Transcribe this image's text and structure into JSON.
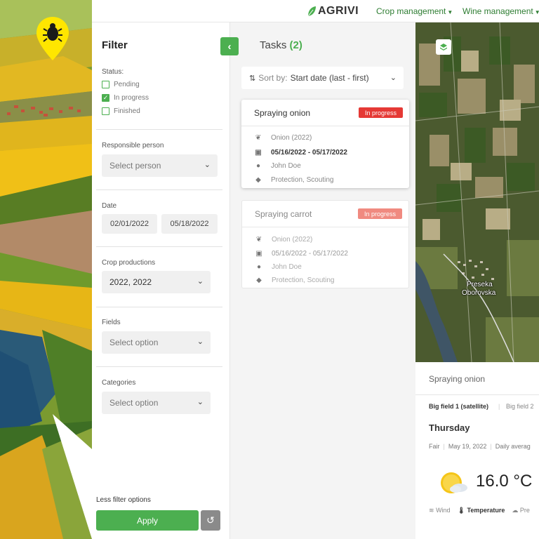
{
  "brand": {
    "logo": "AGRIVI"
  },
  "nav": [
    {
      "label": "Crop management"
    },
    {
      "label": "Wine management"
    }
  ],
  "filter": {
    "title": "Filter",
    "status_label": "Status:",
    "statuses": [
      {
        "label": "Pending",
        "checked": false
      },
      {
        "label": "In progress",
        "checked": true
      },
      {
        "label": "Finished",
        "checked": false
      }
    ],
    "responsible_label": "Responsible person",
    "responsible_placeholder": "Select person",
    "date_label": "Date",
    "date_from": "02/01/2022",
    "date_to": "05/18/2022",
    "crop_label": "Crop productions",
    "crop_value": "2022, 2022",
    "fields_label": "Fields",
    "fields_placeholder": "Select option",
    "categories_label": "Categories",
    "categories_placeholder": "Select option",
    "less_link": "Less filter options",
    "apply": "Apply"
  },
  "tasks": {
    "title": "Tasks",
    "count": "(2)",
    "sort_label": "Sort by:",
    "sort_value": "Start date (last - first)",
    "items": [
      {
        "title": "Spraying onion",
        "status": "In progress",
        "crop": "Onion (2022)",
        "dates": "05/16/2022 - 05/17/2022",
        "person": "John Doe",
        "tags": "Protection, Scouting"
      },
      {
        "title": "Spraying carrot",
        "status": "In progress",
        "crop": "Onion (2022)",
        "dates": "05/16/2022 - 05/17/2022",
        "person": "John Doe",
        "tags": "Protection, Scouting"
      }
    ]
  },
  "map": {
    "labels": [
      "Preseka",
      "Oborovska"
    ]
  },
  "weather": {
    "title": "Spraying onion",
    "fields": [
      "Big field 1 (satellite)",
      "Big field 2"
    ],
    "day": "Thursday",
    "condition": "Fair",
    "date": "May 19, 2022",
    "mode": "Daily averag",
    "temperature": "16.0 °C",
    "metrics": [
      "Wind",
      "Temperature",
      "Pre"
    ]
  },
  "colors": {
    "accent": "#4caf50",
    "status_badge": "#e53935",
    "pin": "#ffe600"
  }
}
